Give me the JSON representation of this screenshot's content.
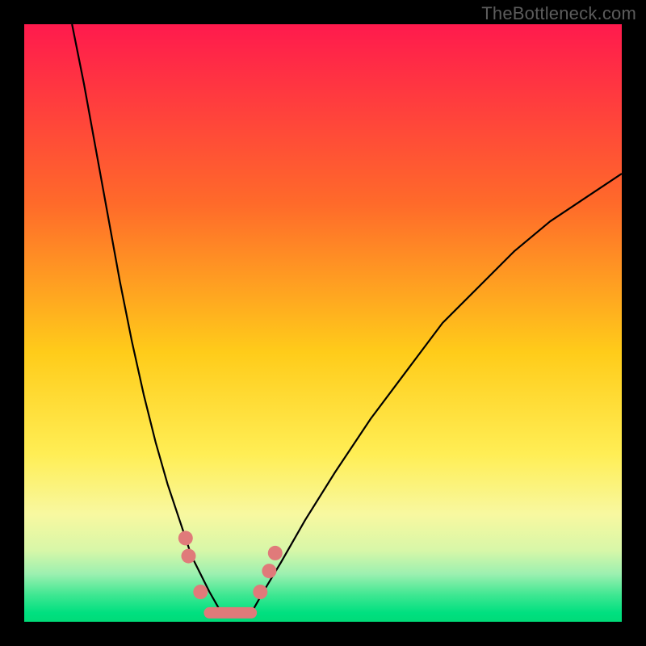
{
  "watermark": "TheBottleneck.com",
  "chart_data": {
    "type": "line",
    "title": "",
    "xlabel": "",
    "ylabel": "",
    "xlim": [
      0,
      100
    ],
    "ylim": [
      0,
      100
    ],
    "grid": false,
    "legend": false,
    "background_gradient": {
      "stops": [
        {
          "offset": 0.0,
          "color": "#ff1a4d"
        },
        {
          "offset": 0.3,
          "color": "#ff6a2a"
        },
        {
          "offset": 0.55,
          "color": "#ffcc1a"
        },
        {
          "offset": 0.72,
          "color": "#ffee55"
        },
        {
          "offset": 0.82,
          "color": "#f8f8a0"
        },
        {
          "offset": 0.88,
          "color": "#d8f7a8"
        },
        {
          "offset": 0.92,
          "color": "#9cf0b0"
        },
        {
          "offset": 0.955,
          "color": "#3fe792"
        },
        {
          "offset": 0.985,
          "color": "#00e080"
        },
        {
          "offset": 1.0,
          "color": "#00db78"
        }
      ]
    },
    "series": [
      {
        "name": "left-curve",
        "x": [
          8,
          10,
          12,
          14,
          16,
          18,
          20,
          22,
          24,
          25,
          26,
          27,
          28,
          29.5,
          31,
          33
        ],
        "y": [
          100,
          90,
          79,
          68,
          57,
          47,
          38,
          30,
          23,
          20,
          17,
          14,
          11,
          8,
          5,
          1.5
        ],
        "color": "#000000",
        "width": 2.2
      },
      {
        "name": "right-curve",
        "x": [
          38,
          40,
          43,
          47,
          52,
          58,
          64,
          70,
          76,
          82,
          88,
          94,
          100
        ],
        "y": [
          1.5,
          5,
          10,
          17,
          25,
          34,
          42,
          50,
          56,
          62,
          67,
          71,
          75
        ],
        "color": "#000000",
        "width": 2.2
      },
      {
        "name": "valley-floor",
        "x": [
          31,
          38
        ],
        "y": [
          1.5,
          1.5
        ],
        "color": "#e07a7a",
        "width": 14,
        "cap": "round"
      }
    ],
    "markers": [
      {
        "x": 27.0,
        "y": 14.0,
        "r": 9,
        "color": "#e07a7a"
      },
      {
        "x": 27.5,
        "y": 11.0,
        "r": 9,
        "color": "#e07a7a"
      },
      {
        "x": 29.5,
        "y": 5.0,
        "r": 9,
        "color": "#e07a7a"
      },
      {
        "x": 39.5,
        "y": 5.0,
        "r": 9,
        "color": "#e07a7a"
      },
      {
        "x": 41.0,
        "y": 8.5,
        "r": 9,
        "color": "#e07a7a"
      },
      {
        "x": 42.0,
        "y": 11.5,
        "r": 9,
        "color": "#e07a7a"
      }
    ]
  }
}
